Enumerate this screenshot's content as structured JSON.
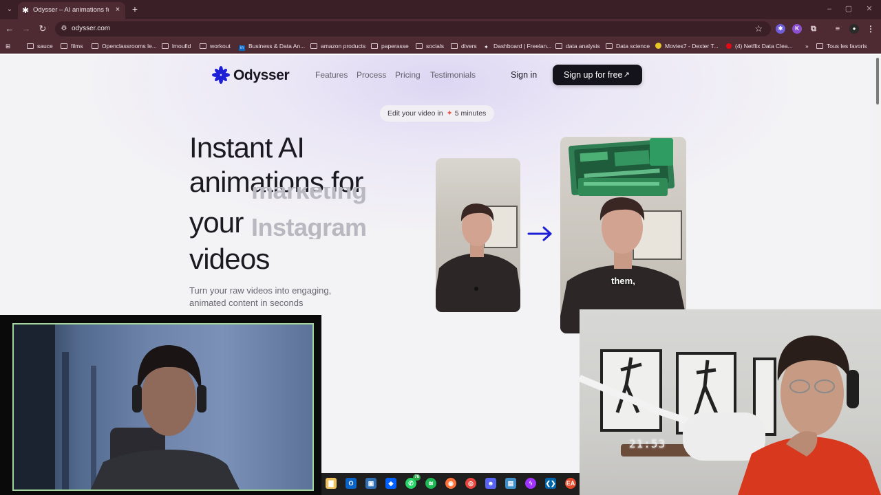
{
  "browser": {
    "tab_title": "Odysser – AI animations for yo...",
    "tab_close_icon": "×",
    "new_tab_icon": "+",
    "url": "odysser.com",
    "bookmarks": [
      "sauce",
      "films",
      "Openclassrooms le...",
      "lmoufid",
      "workout",
      "Business & Data An...",
      "amazon products",
      "paperasse",
      "socials",
      "divers",
      "Dashboard | Freelan...",
      "data analysis",
      "Data science",
      "Movies7 - Dexter T...",
      "(4) Netflix Data Clea...",
      "Tous les favoris"
    ],
    "overflow_chevron": "»"
  },
  "site": {
    "brand": "Odysser",
    "nav": [
      "Features",
      "Process",
      "Pricing",
      "Testimonials"
    ],
    "sign_in": "Sign in",
    "sign_up": "Sign up for free",
    "sign_up_arrow": "↗",
    "pill_prefix": "Edit your video in",
    "pill_suffix": "5 minutes",
    "headline": [
      "Instant AI",
      "animations for",
      "your",
      "videos"
    ],
    "rotating_words": [
      "marketing",
      "Instagram"
    ],
    "subtitle": "Turn your raw videos into engaging, animated content in seconds",
    "caption": "them,",
    "brand_color": "#1d1fd6"
  },
  "overlay": {
    "clock": "21:53"
  }
}
